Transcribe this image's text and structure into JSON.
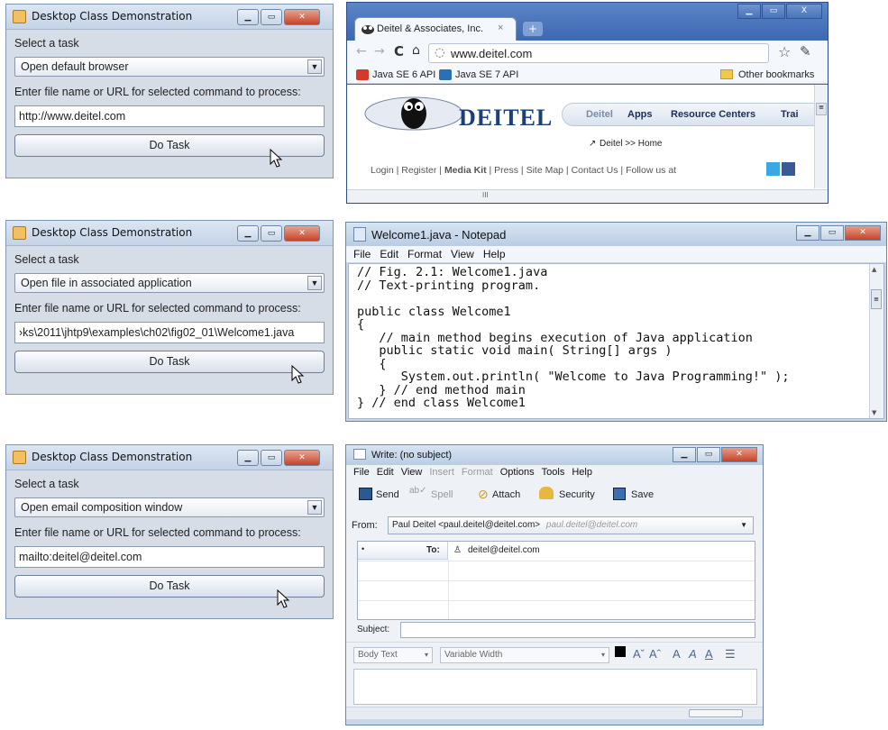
{
  "java_windows": [
    {
      "title": "Desktop Class Demonstration",
      "select_label": "Select a task",
      "combo_value": "Open default browser",
      "input_label": "Enter file name or URL for selected command to process:",
      "input_value": "http://www.deitel.com",
      "button_label": "Do Task"
    },
    {
      "title": "Desktop Class Demonstration",
      "select_label": "Select a task",
      "combo_value": "Open file in associated application",
      "input_label": "Enter file name or URL for selected command to process:",
      "input_value": "›ks\\2011\\jhtp9\\examples\\ch02\\fig02_01\\Welcome1.java",
      "button_label": "Do Task"
    },
    {
      "title": "Desktop Class Demonstration",
      "select_label": "Select a task",
      "combo_value": "Open email composition window",
      "input_label": "Enter file name or URL for selected command to process:",
      "input_value": "mailto:deitel@deitel.com",
      "button_label": "Do Task"
    }
  ],
  "browser": {
    "tab_title": "Deitel & Associates, Inc.",
    "tab_close": "×",
    "new_tab": "+",
    "url": "www.deitel.com",
    "bookmarks": [
      "Java SE 6 API",
      "Java SE 7 API"
    ],
    "other_bookmarks": "Other bookmarks",
    "logo_text": "DEITEL",
    "nav": [
      "Deitel",
      "Apps",
      "Resource Centers",
      "Trai"
    ],
    "breadcrumb": "Deitel >> Home",
    "footer": [
      "Login",
      "Register",
      "Media Kit",
      "Press",
      "Site Map",
      "Contact Us",
      "Follow us at"
    ],
    "scroll_mark": "III"
  },
  "notepad": {
    "title": "Welcome1.java - Notepad",
    "menu": [
      "File",
      "Edit",
      "Format",
      "View",
      "Help"
    ],
    "code_lines": [
      "// Fig. 2.1: Welcome1.java",
      "// Text-printing program.",
      "",
      "public class Welcome1",
      "{",
      "   // main method begins execution of Java application",
      "   public static void main( String[] args )",
      "   {",
      "      System.out.println( \"Welcome to Java Programming!\" );",
      "   } // end method main",
      "} // end class Welcome1"
    ]
  },
  "mail": {
    "title": "Write: (no subject)",
    "menu": [
      "File",
      "Edit",
      "View",
      "Insert",
      "Format",
      "Options",
      "Tools",
      "Help"
    ],
    "toolbar": {
      "send": "Send",
      "spell": "Spell",
      "attach": "Attach",
      "security": "Security",
      "save": "Save"
    },
    "from_label": "From:",
    "from_value": "Paul Deitel <paul.deitel@deitel.com>",
    "from_hint": "paul.deitel@deitel.com",
    "to_label": "To:",
    "to_value": "deitel@deitel.com",
    "subject_label": "Subject:",
    "format_style": "Body Text",
    "format_font": "Variable Width"
  }
}
